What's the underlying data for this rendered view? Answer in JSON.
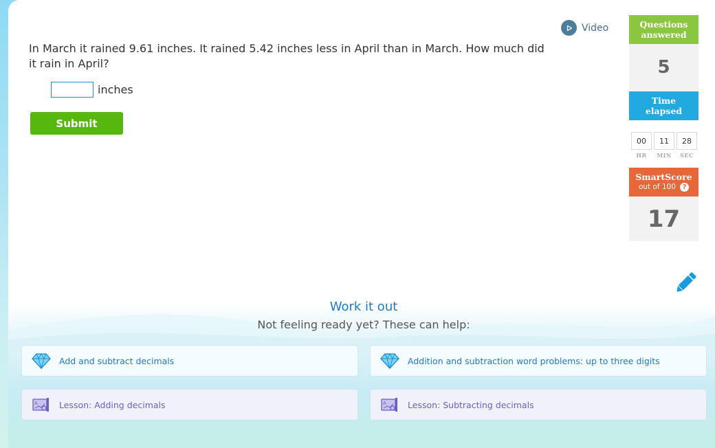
{
  "question": {
    "text": "In March it rained 9.61 inches. It rained 5.42 inches less in April than in March. How much did it rain in April?",
    "answer_value": "",
    "unit": "inches"
  },
  "submit_label": "Submit",
  "video_label": "Video",
  "sidebar": {
    "questions_answered_label_1": "Questions",
    "questions_answered_label_2": "answered",
    "questions_answered_value": "5",
    "time_elapsed_label_1": "Time",
    "time_elapsed_label_2": "elapsed",
    "time": {
      "hr": "00",
      "min": "11",
      "sec": "28"
    },
    "time_units": {
      "hr": "HR",
      "min": "MIN",
      "sec": "SEC"
    },
    "smartscore_label": "SmartScore",
    "smartscore_sub": "out of 100",
    "smartscore_help": "?",
    "smartscore_value": "17"
  },
  "help": {
    "title": "Work it out",
    "subtitle": "Not feeling ready yet? These can help:",
    "items": [
      {
        "label": "Add and subtract decimals",
        "icon": "diamond-icon"
      },
      {
        "label": "Addition and subtraction word problems: up to three digits",
        "icon": "diamond-icon"
      },
      {
        "label": "Lesson: Adding decimals",
        "icon": "lesson-icon"
      },
      {
        "label": "Lesson: Subtracting decimals",
        "icon": "lesson-icon"
      }
    ]
  },
  "colors": {
    "submit": "#56b80f",
    "questions_header": "#8ac63f",
    "time_header": "#22aae0",
    "smartscore_header": "#e5673a",
    "link": "#1e7bc6",
    "lesson_link": "#6a5fc1"
  }
}
